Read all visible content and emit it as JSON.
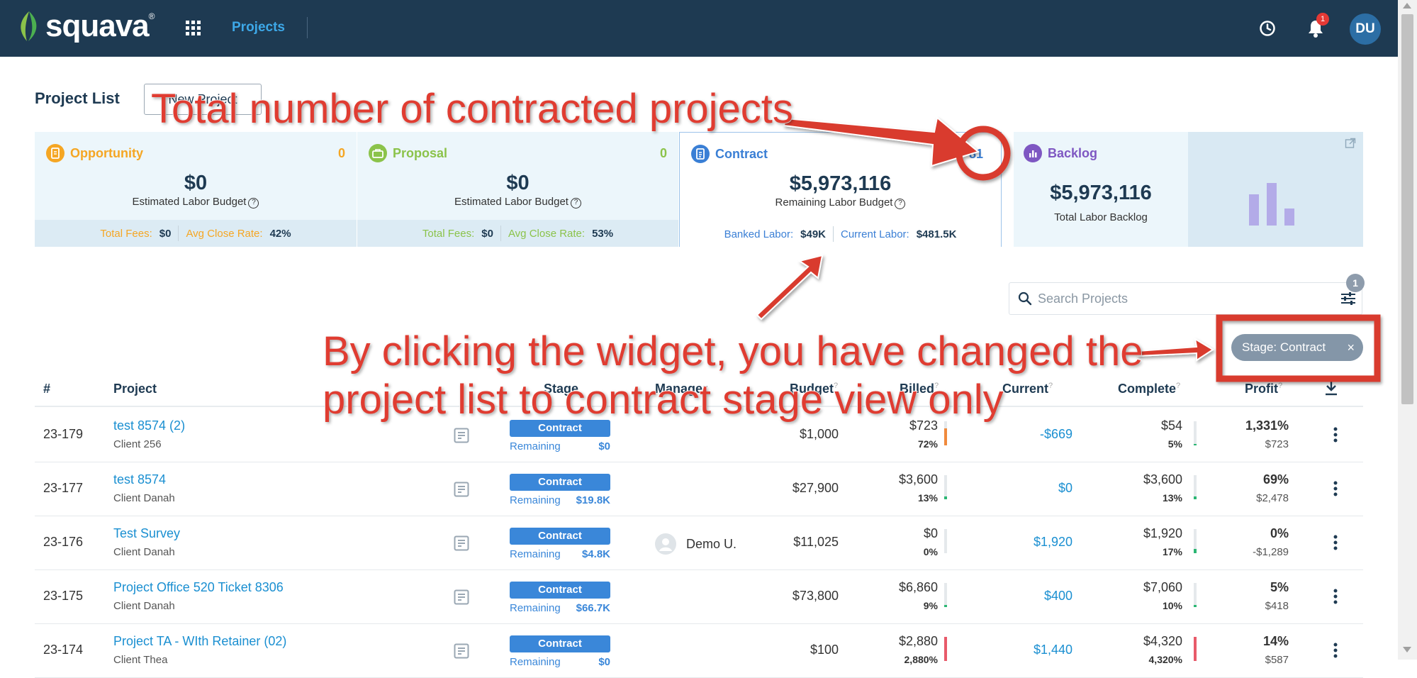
{
  "app": {
    "logo_text": "squava",
    "trademark": "®",
    "nav_projects": "Projects",
    "avatar_initials": "DU",
    "notification_count": "1"
  },
  "page": {
    "title": "Project List",
    "new_project_label": "New Project"
  },
  "cards": {
    "opportunity": {
      "label": "Opportunity",
      "count": "0",
      "amount": "$0",
      "subtitle": "Estimated Labor Budget",
      "stat1_label": "Total Fees:",
      "stat1_value": "$0",
      "stat2_label": "Avg Close Rate:",
      "stat2_value": "42%",
      "color": "#f5a623"
    },
    "proposal": {
      "label": "Proposal",
      "count": "0",
      "amount": "$0",
      "subtitle": "Estimated Labor Budget",
      "stat1_label": "Total Fees:",
      "stat1_value": "$0",
      "stat2_label": "Avg Close Rate:",
      "stat2_value": "53%",
      "color": "#8bc34a"
    },
    "contract": {
      "label": "Contract",
      "count": "81",
      "amount": "$5,973,116",
      "subtitle": "Remaining Labor Budget",
      "stat1_label": "Banked Labor:",
      "stat1_value": "$49K",
      "stat2_label": "Current Labor:",
      "stat2_value": "$481.5K",
      "color": "#3a7fd5"
    },
    "backlog": {
      "label": "Backlog",
      "amount": "$5,973,116",
      "subtitle": "Total Labor Backlog",
      "color": "#7e57c2",
      "chart_color": "#b3abe8",
      "bar_levels": [
        0.55,
        0.75,
        0.3
      ]
    }
  },
  "search": {
    "placeholder": "Search Projects",
    "filter_count": "1"
  },
  "filter_chip": {
    "label": "Stage: Contract",
    "close": "×"
  },
  "table": {
    "headers": {
      "num": "#",
      "project": "Project",
      "stage": "Stage",
      "manager": "Manager",
      "budget": "Budget",
      "billed": "Billed",
      "current": "Current",
      "complete": "Complete",
      "profit": "Profit"
    },
    "rows": [
      {
        "num": "23-179",
        "name": "test 8574 (2)",
        "client": "Client 256",
        "stage": "Contract",
        "remaining_label": "Remaining",
        "remaining_value": "$0",
        "manager": "",
        "budget": "$1,000",
        "billed": "$723",
        "billed_pct": "72%",
        "billed_bar": 0.72,
        "billed_color": "#f08a3c",
        "current": "-$669",
        "complete": "$54",
        "complete_pct": "5%",
        "complete_bar": 0.05,
        "complete_color": "#2bb673",
        "profit_pct": "1,331%",
        "profit_amt": "$723"
      },
      {
        "num": "23-177",
        "name": "test 8574",
        "client": "Client Danah",
        "stage": "Contract",
        "remaining_label": "Remaining",
        "remaining_value": "$19.8K",
        "manager": "",
        "budget": "$27,900",
        "billed": "$3,600",
        "billed_pct": "13%",
        "billed_bar": 0.13,
        "billed_color": "#2bb673",
        "current": "$0",
        "complete": "$3,600",
        "complete_pct": "13%",
        "complete_bar": 0.13,
        "complete_color": "#2bb673",
        "profit_pct": "69%",
        "profit_amt": "$2,478"
      },
      {
        "num": "23-176",
        "name": "Test Survey",
        "client": "Client Danah",
        "stage": "Contract",
        "remaining_label": "Remaining",
        "remaining_value": "$4.8K",
        "manager": "Demo U.",
        "budget": "$11,025",
        "billed": "$0",
        "billed_pct": "0%",
        "billed_bar": 0,
        "billed_color": "#2bb673",
        "current": "$1,920",
        "complete": "$1,920",
        "complete_pct": "17%",
        "complete_bar": 0.17,
        "complete_color": "#2bb673",
        "profit_pct": "0%",
        "profit_amt": "-$1,289"
      },
      {
        "num": "23-175",
        "name": "Project Office 520 Ticket 8306",
        "client": "Client Danah",
        "stage": "Contract",
        "remaining_label": "Remaining",
        "remaining_value": "$66.7K",
        "manager": "",
        "budget": "$73,800",
        "billed": "$6,860",
        "billed_pct": "9%",
        "billed_bar": 0.09,
        "billed_color": "#2bb673",
        "current": "$400",
        "complete": "$7,060",
        "complete_pct": "10%",
        "complete_bar": 0.1,
        "complete_color": "#2bb673",
        "profit_pct": "5%",
        "profit_amt": "$418"
      },
      {
        "num": "23-174",
        "name": "Project TA - WIth Retainer (02)",
        "client": "Client Thea",
        "stage": "Contract",
        "remaining_label": "Remaining",
        "remaining_value": "$0",
        "manager": "",
        "budget": "$100",
        "billed": "$2,880",
        "billed_pct": "2,880%",
        "billed_bar": 1,
        "billed_color": "#e85a6a",
        "current": "$1,440",
        "complete": "$4,320",
        "complete_pct": "4,320%",
        "complete_bar": 1,
        "complete_color": "#e85a6a",
        "profit_pct": "14%",
        "profit_amt": "$587"
      }
    ]
  },
  "annotations": {
    "top": "Total number of contracted projects",
    "bottom_line1": "By clicking the widget, you have changed the",
    "bottom_line2": "project list to contract stage view only",
    "color": "#d93b2f"
  }
}
